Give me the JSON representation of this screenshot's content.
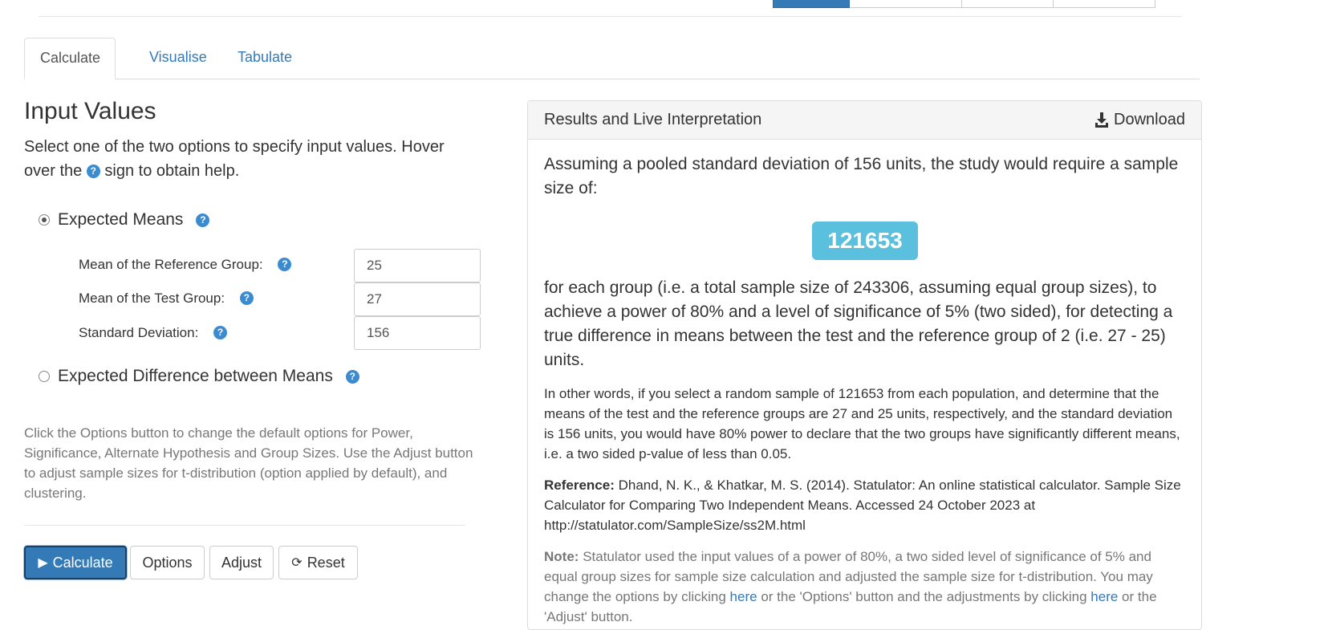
{
  "tabs": [
    {
      "label": "Calculate",
      "active": true
    },
    {
      "label": "Visualise",
      "active": false
    },
    {
      "label": "Tabulate",
      "active": false
    }
  ],
  "input": {
    "heading": "Input Values",
    "intro_before": "Select one of the two options to specify input values. Hover over the",
    "intro_after": "sign to obtain help.",
    "option_means": "Expected Means",
    "option_diff": "Expected Difference between Means",
    "fields": [
      {
        "label": "Mean of the Reference Group:",
        "value": "25"
      },
      {
        "label": "Mean of the Test Group:",
        "value": "27"
      },
      {
        "label": "Standard Deviation:",
        "value": "156"
      }
    ],
    "options_note": "Click the Options button to change the default options for Power, Significance, Alternate Hypothesis and Group Sizes. Use the Adjust button to adjust sample sizes for t-distribution (option applied by default), and clustering."
  },
  "buttons": {
    "calculate": "Calculate",
    "options": "Options",
    "adjust": "Adjust",
    "reset": "Reset"
  },
  "results": {
    "title": "Results and Live Interpretation",
    "download": "Download",
    "lead": "Assuming a pooled standard deviation of 156 units, the study would require a sample size of:",
    "sample_size": "121653",
    "lead2": "for each group (i.e. a total sample size of 243306, assuming equal group sizes), to achieve a power of 80% and a level of significance of 5% (two sided), for detecting a true difference in means between the test and the reference group of 2 (i.e. 27 - 25) units.",
    "in_other_words": "In other words, if you select a random sample of 121653 from each population, and determine that the means of the test and the reference groups are 27 and 25 units, respectively, and the standard deviation is 156 units, you would have 80% power to declare that the two groups have significantly different means, i.e. a two sided p-value of less than 0.05.",
    "reference_label": "Reference:",
    "reference_text": "Dhand, N. K., & Khatkar, M. S. (2014). Statulator: An online statistical calculator. Sample Size Calculator for Comparing Two Independent Means. Accessed 24 October 2023 at http://statulator.com/SampleSize/ss2M.html",
    "note_label": "Note:",
    "note_text1": "Statulator used the input values of a power of 80%, a two sided level of significance of 5% and equal group sizes for sample size calculation and adjusted the sample size for t-distribution. You may change the options by clicking",
    "note_link1": "here",
    "note_text2": "or the 'Options' button and the adjustments by clicking",
    "note_link2": "here",
    "note_text3": "or the 'Adjust' button."
  },
  "colors": {
    "primary": "#337ab7",
    "badge": "#5bc0de",
    "help_icon": "#3b8bd0",
    "muted_text": "#777777"
  },
  "icons": {
    "help": "question-circle-icon",
    "download": "download-icon",
    "play": "play-icon",
    "refresh": "refresh-icon"
  }
}
